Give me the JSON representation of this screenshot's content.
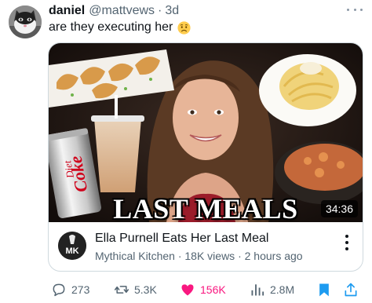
{
  "author": {
    "display_name": "daniel",
    "handle": "@mattvews",
    "separator": "·",
    "age": "3d",
    "avatar_icon": "cat-avatar"
  },
  "tweet": {
    "text": "are they executing her",
    "emoji": "worried-face-emoji"
  },
  "card": {
    "thumbnail_overlay_text": "LAST MEALS",
    "duration": "34:36",
    "can_logo_text": "Coke",
    "can_logo_subtext": "Diet",
    "channel_icon": "mythical-kitchen-logo",
    "channel_icon_text": "MK",
    "video_title": "Ella Purnell Eats Her Last Meal",
    "video_subtitle": "Mythical Kitchen · 18K views · 2 hours ago"
  },
  "actions": {
    "replies": "273",
    "retweets": "5.3K",
    "likes": "156K",
    "views": "2.8M",
    "like_color": "#f91880",
    "bookmark_color": "#1d9bf0",
    "share_color": "#1d9bf0"
  }
}
